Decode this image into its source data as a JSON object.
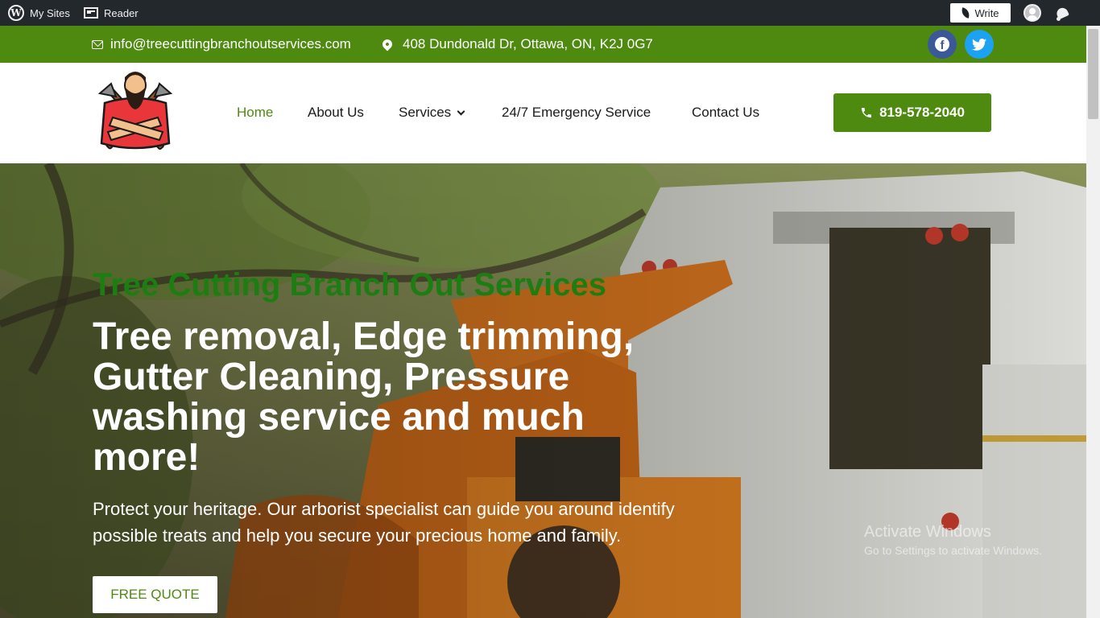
{
  "admin_bar": {
    "my_sites": "My Sites",
    "reader": "Reader",
    "write": "Write"
  },
  "top_bar": {
    "email": "info@treecuttingbranchoutservices.com",
    "address": "408 Dundonald Dr, Ottawa, ON, K2J 0G7",
    "icons": [
      "envelope-icon",
      "map-pin-icon",
      "facebook-icon",
      "twitter-icon"
    ]
  },
  "nav": {
    "items": [
      "Home",
      "About Us",
      "Services",
      "24/7 Emergency Service",
      "Contact Us"
    ],
    "active": "Home",
    "phone": "819-578-2040"
  },
  "hero": {
    "kicker": "Tree Cutting Branch Out Services",
    "title": "Tree removal, Edge trimming, Gutter Cleaning, Pressure washing service and much more!",
    "subtitle": "Protect your heritage. Our arborist specialist can guide you around identify possible treats and help you secure your precious home and family.",
    "cta": "FREE QUOTE"
  },
  "watermark": {
    "title": "Activate Windows",
    "subtitle": "Go to Settings to activate Windows."
  },
  "colors": {
    "brand_green": "#4e8a0f",
    "kicker_green": "#1e7d12",
    "admin_bar": "#23282d",
    "facebook": "#3b5998",
    "twitter": "#1da1f2"
  }
}
